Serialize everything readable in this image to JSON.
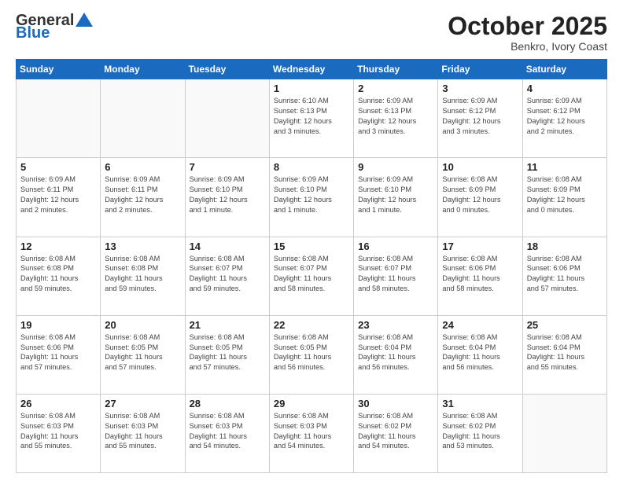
{
  "logo": {
    "general": "General",
    "blue": "Blue"
  },
  "header": {
    "month": "October 2025",
    "location": "Benkro, Ivory Coast"
  },
  "weekdays": [
    "Sunday",
    "Monday",
    "Tuesday",
    "Wednesday",
    "Thursday",
    "Friday",
    "Saturday"
  ],
  "weeks": [
    [
      {
        "day": "",
        "info": ""
      },
      {
        "day": "",
        "info": ""
      },
      {
        "day": "",
        "info": ""
      },
      {
        "day": "1",
        "info": "Sunrise: 6:10 AM\nSunset: 6:13 PM\nDaylight: 12 hours\nand 3 minutes."
      },
      {
        "day": "2",
        "info": "Sunrise: 6:09 AM\nSunset: 6:13 PM\nDaylight: 12 hours\nand 3 minutes."
      },
      {
        "day": "3",
        "info": "Sunrise: 6:09 AM\nSunset: 6:12 PM\nDaylight: 12 hours\nand 3 minutes."
      },
      {
        "day": "4",
        "info": "Sunrise: 6:09 AM\nSunset: 6:12 PM\nDaylight: 12 hours\nand 2 minutes."
      }
    ],
    [
      {
        "day": "5",
        "info": "Sunrise: 6:09 AM\nSunset: 6:11 PM\nDaylight: 12 hours\nand 2 minutes."
      },
      {
        "day": "6",
        "info": "Sunrise: 6:09 AM\nSunset: 6:11 PM\nDaylight: 12 hours\nand 2 minutes."
      },
      {
        "day": "7",
        "info": "Sunrise: 6:09 AM\nSunset: 6:10 PM\nDaylight: 12 hours\nand 1 minute."
      },
      {
        "day": "8",
        "info": "Sunrise: 6:09 AM\nSunset: 6:10 PM\nDaylight: 12 hours\nand 1 minute."
      },
      {
        "day": "9",
        "info": "Sunrise: 6:09 AM\nSunset: 6:10 PM\nDaylight: 12 hours\nand 1 minute."
      },
      {
        "day": "10",
        "info": "Sunrise: 6:08 AM\nSunset: 6:09 PM\nDaylight: 12 hours\nand 0 minutes."
      },
      {
        "day": "11",
        "info": "Sunrise: 6:08 AM\nSunset: 6:09 PM\nDaylight: 12 hours\nand 0 minutes."
      }
    ],
    [
      {
        "day": "12",
        "info": "Sunrise: 6:08 AM\nSunset: 6:08 PM\nDaylight: 11 hours\nand 59 minutes."
      },
      {
        "day": "13",
        "info": "Sunrise: 6:08 AM\nSunset: 6:08 PM\nDaylight: 11 hours\nand 59 minutes."
      },
      {
        "day": "14",
        "info": "Sunrise: 6:08 AM\nSunset: 6:07 PM\nDaylight: 11 hours\nand 59 minutes."
      },
      {
        "day": "15",
        "info": "Sunrise: 6:08 AM\nSunset: 6:07 PM\nDaylight: 11 hours\nand 58 minutes."
      },
      {
        "day": "16",
        "info": "Sunrise: 6:08 AM\nSunset: 6:07 PM\nDaylight: 11 hours\nand 58 minutes."
      },
      {
        "day": "17",
        "info": "Sunrise: 6:08 AM\nSunset: 6:06 PM\nDaylight: 11 hours\nand 58 minutes."
      },
      {
        "day": "18",
        "info": "Sunrise: 6:08 AM\nSunset: 6:06 PM\nDaylight: 11 hours\nand 57 minutes."
      }
    ],
    [
      {
        "day": "19",
        "info": "Sunrise: 6:08 AM\nSunset: 6:06 PM\nDaylight: 11 hours\nand 57 minutes."
      },
      {
        "day": "20",
        "info": "Sunrise: 6:08 AM\nSunset: 6:05 PM\nDaylight: 11 hours\nand 57 minutes."
      },
      {
        "day": "21",
        "info": "Sunrise: 6:08 AM\nSunset: 6:05 PM\nDaylight: 11 hours\nand 57 minutes."
      },
      {
        "day": "22",
        "info": "Sunrise: 6:08 AM\nSunset: 6:05 PM\nDaylight: 11 hours\nand 56 minutes."
      },
      {
        "day": "23",
        "info": "Sunrise: 6:08 AM\nSunset: 6:04 PM\nDaylight: 11 hours\nand 56 minutes."
      },
      {
        "day": "24",
        "info": "Sunrise: 6:08 AM\nSunset: 6:04 PM\nDaylight: 11 hours\nand 56 minutes."
      },
      {
        "day": "25",
        "info": "Sunrise: 6:08 AM\nSunset: 6:04 PM\nDaylight: 11 hours\nand 55 minutes."
      }
    ],
    [
      {
        "day": "26",
        "info": "Sunrise: 6:08 AM\nSunset: 6:03 PM\nDaylight: 11 hours\nand 55 minutes."
      },
      {
        "day": "27",
        "info": "Sunrise: 6:08 AM\nSunset: 6:03 PM\nDaylight: 11 hours\nand 55 minutes."
      },
      {
        "day": "28",
        "info": "Sunrise: 6:08 AM\nSunset: 6:03 PM\nDaylight: 11 hours\nand 54 minutes."
      },
      {
        "day": "29",
        "info": "Sunrise: 6:08 AM\nSunset: 6:03 PM\nDaylight: 11 hours\nand 54 minutes."
      },
      {
        "day": "30",
        "info": "Sunrise: 6:08 AM\nSunset: 6:02 PM\nDaylight: 11 hours\nand 54 minutes."
      },
      {
        "day": "31",
        "info": "Sunrise: 6:08 AM\nSunset: 6:02 PM\nDaylight: 11 hours\nand 53 minutes."
      },
      {
        "day": "",
        "info": ""
      }
    ]
  ]
}
